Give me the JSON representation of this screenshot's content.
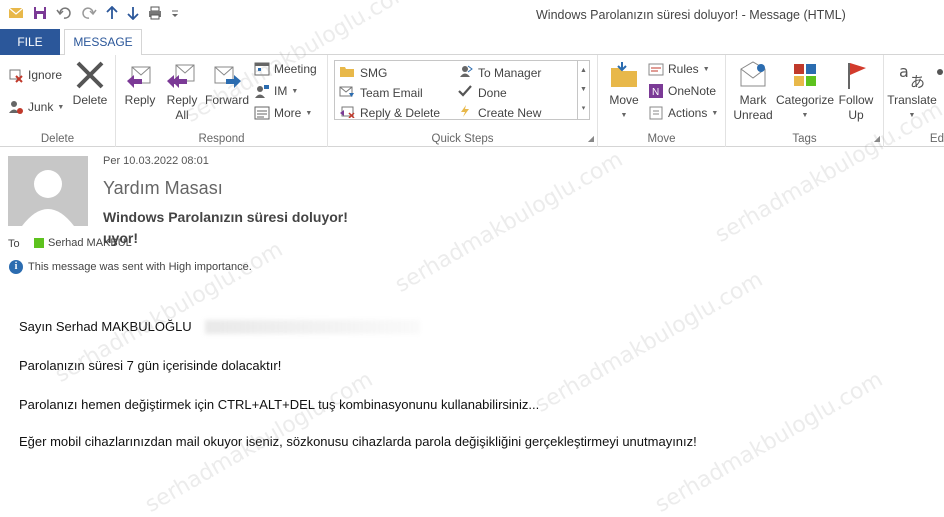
{
  "window": {
    "title": "Windows Parolanızın süresi doluyor! - Message (HTML)"
  },
  "quick_access": [
    "mail-icon",
    "save-icon",
    "undo-icon",
    "redo-icon",
    "up-arrow-icon",
    "down-arrow-icon",
    "print-icon",
    "customize-icon"
  ],
  "tabs": {
    "file": "FILE",
    "message": "MESSAGE"
  },
  "ribbon": {
    "delete_group": {
      "label": "Delete",
      "ignore": "Ignore",
      "junk": "Junk",
      "delete": "Delete"
    },
    "respond_group": {
      "label": "Respond",
      "reply": "Reply",
      "reply_all_1": "Reply",
      "reply_all_2": "All",
      "forward": "Forward",
      "meeting": "Meeting",
      "im": "IM",
      "more": "More"
    },
    "quick_steps_group": {
      "label": "Quick Steps",
      "items": [
        "SMG",
        "Team Email",
        "Reply & Delete",
        "To Manager",
        "Done",
        "Create New"
      ]
    },
    "move_group": {
      "label": "Move",
      "move": "Move",
      "rules": "Rules",
      "onenote": "OneNote",
      "actions": "Actions"
    },
    "tags_group": {
      "label": "Tags",
      "mark_unread_1": "Mark",
      "mark_unread_2": "Unread",
      "categorize": "Categorize",
      "follow_up_1": "Follow",
      "follow_up_2": "Up"
    },
    "editing_group": {
      "label": "Ed",
      "translate": "Translate"
    }
  },
  "message": {
    "date": "Per 10.03.2022 08:01",
    "sender": "Yardım Masası",
    "subject": "Windows Parolanızın süresi doluyor!",
    "subject_ghost": "uyor!",
    "to_label": "To",
    "to_value": "Serhad MAKBUL",
    "importance": "This message was sent with High importance.",
    "body": [
      "Sayın Serhad MAKBULOĞLU",
      "Parolanızın süresi 7 gün içerisinde dolacaktır!",
      "Parolanızı hemen değiştirmek için CTRL+ALT+DEL tuş kombinasyonunu kullanabilirsiniz...",
      "Eğer mobil cihazlarınızdan mail okuyor iseniz, sözkonusu cihazlarda parola değişikliğini gerçekleştirmeyi unutmayınız!"
    ]
  },
  "watermark": "serhadmakbuloglu.com",
  "colors": {
    "accent": "#2b579a",
    "presence": "#5dc21e"
  }
}
